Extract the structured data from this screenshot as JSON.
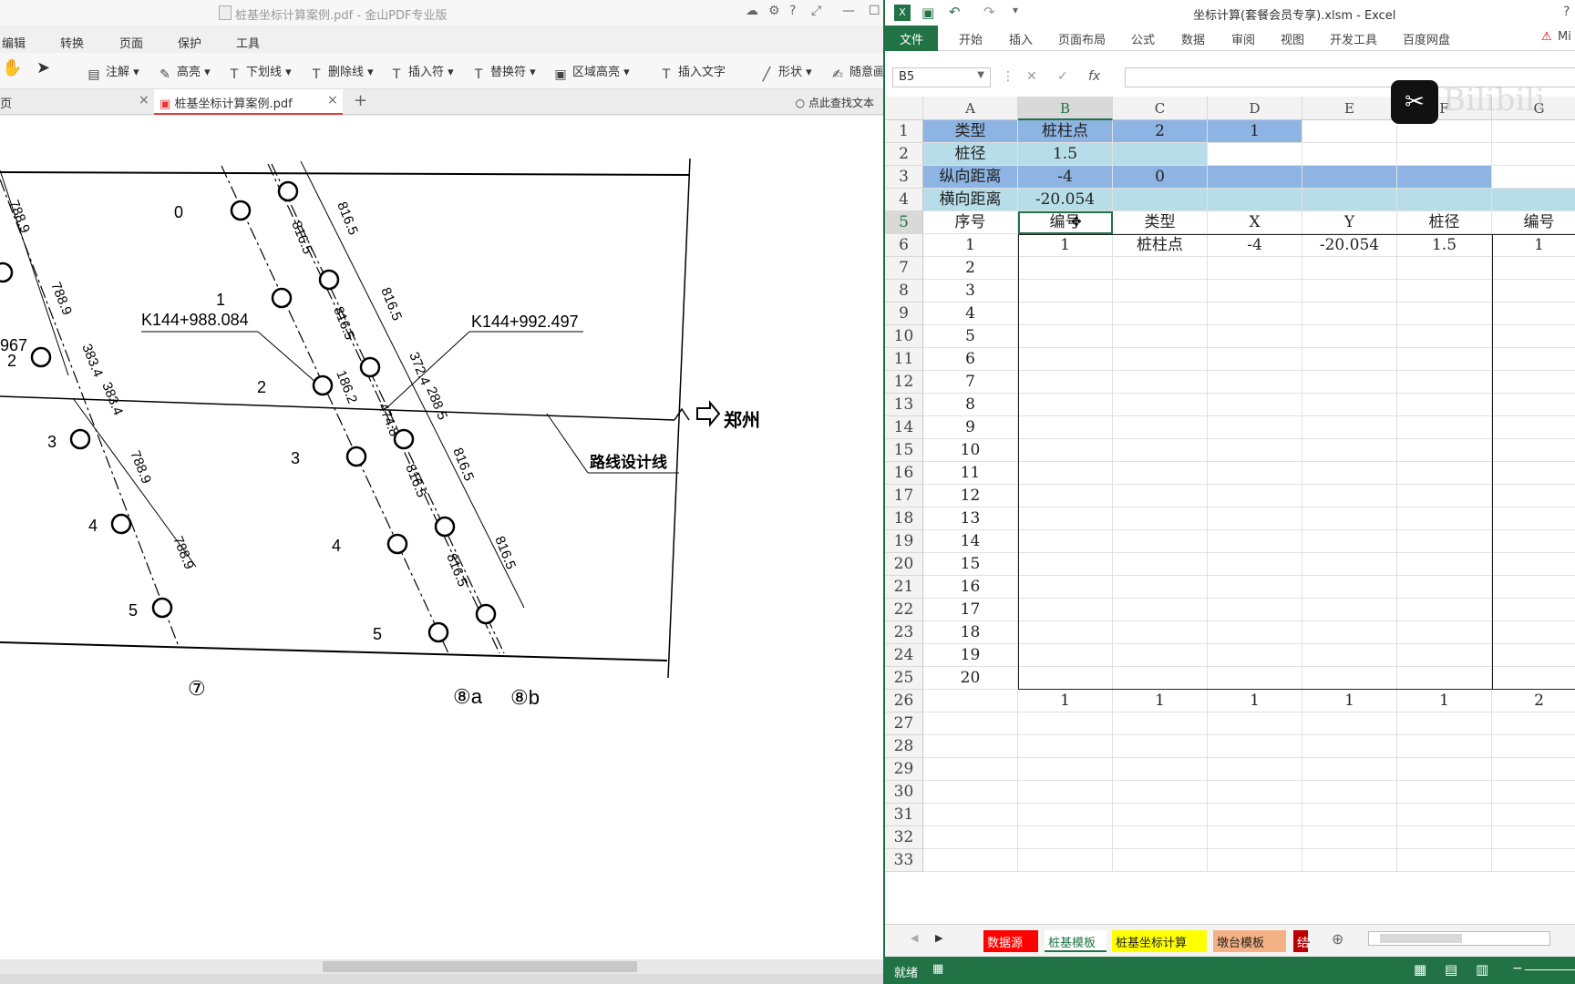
{
  "pdf": {
    "title": "桩基坐标计算案例.pdf - 金山PDF专业版",
    "menu": [
      "编辑",
      "转换",
      "页面",
      "保护",
      "工具"
    ],
    "tools": [
      "注解",
      "高亮",
      "下划线",
      "删除线",
      "插入符",
      "替换符",
      "区域高亮",
      "插入文字",
      "形状",
      "随意画"
    ],
    "tabs": [
      "页",
      "桩基坐标计算案例.pdf"
    ],
    "search_text": "点此查找文本",
    "drawing": {
      "station_left": "K144+988.084",
      "station_right": "K144+992.497",
      "direction": "郑州",
      "route_label": "路线设计线",
      "pier_labels": [
        "⑦",
        "⑧a",
        "⑧b"
      ],
      "dims_left": [
        "788.9",
        "788.9",
        "383.4",
        "383.4",
        "788.9",
        "788.9"
      ],
      "dims_right": [
        "816.5",
        "816.5",
        "816.5",
        "816.5",
        "816.5",
        "816.5",
        "816.5",
        "816.5"
      ],
      "dims_mid": [
        "372.4",
        "288.5",
        "186.2",
        "474.8"
      ],
      "row_numbers": [
        "0",
        "1",
        "2",
        "3",
        "4",
        "5"
      ],
      "partial_left": "967",
      "partial_left_num": "2"
    }
  },
  "excel": {
    "title": "坐标计算(套餐会员专享).xlsm - Excel",
    "ribbon": [
      "文件",
      "开始",
      "插入",
      "页面布局",
      "公式",
      "数据",
      "审阅",
      "视图",
      "开发工具",
      "百度网盘"
    ],
    "ribbon_extra": "Mi",
    "name_box": "B5",
    "columns": [
      "A",
      "B",
      "C",
      "D",
      "E",
      "F",
      "G"
    ],
    "rows": [
      [
        "类型",
        "桩柱点",
        "2",
        "1",
        "",
        "",
        ""
      ],
      [
        "桩径",
        "1.5",
        "",
        "",
        "",
        "",
        ""
      ],
      [
        "纵向距离",
        "-4",
        "0",
        "",
        "",
        "",
        ""
      ],
      [
        "横向距离",
        "-20.054",
        "",
        "",
        "",
        "",
        ""
      ],
      [
        "序号",
        "编号",
        "类型",
        "X",
        "Y",
        "桩径",
        "编号"
      ],
      [
        "1",
        "1",
        "桩柱点",
        "-4",
        "-20.054",
        "1.5",
        "1"
      ],
      [
        "2",
        "",
        "",
        "",
        "",
        "",
        ""
      ],
      [
        "3",
        "",
        "",
        "",
        "",
        "",
        ""
      ],
      [
        "4",
        "",
        "",
        "",
        "",
        "",
        ""
      ],
      [
        "5",
        "",
        "",
        "",
        "",
        "",
        ""
      ],
      [
        "6",
        "",
        "",
        "",
        "",
        "",
        ""
      ],
      [
        "7",
        "",
        "",
        "",
        "",
        "",
        ""
      ],
      [
        "8",
        "",
        "",
        "",
        "",
        "",
        ""
      ],
      [
        "9",
        "",
        "",
        "",
        "",
        "",
        ""
      ],
      [
        "10",
        "",
        "",
        "",
        "",
        "",
        ""
      ],
      [
        "11",
        "",
        "",
        "",
        "",
        "",
        ""
      ],
      [
        "12",
        "",
        "",
        "",
        "",
        "",
        ""
      ],
      [
        "13",
        "",
        "",
        "",
        "",
        "",
        ""
      ],
      [
        "14",
        "",
        "",
        "",
        "",
        "",
        ""
      ],
      [
        "15",
        "",
        "",
        "",
        "",
        "",
        ""
      ],
      [
        "16",
        "",
        "",
        "",
        "",
        "",
        ""
      ],
      [
        "17",
        "",
        "",
        "",
        "",
        "",
        ""
      ],
      [
        "18",
        "",
        "",
        "",
        "",
        "",
        ""
      ],
      [
        "19",
        "",
        "",
        "",
        "",
        "",
        ""
      ],
      [
        "20",
        "",
        "",
        "",
        "",
        "",
        ""
      ],
      [
        "",
        "1",
        "1",
        "1",
        "1",
        "1",
        "2"
      ],
      [
        "",
        "",
        "",
        "",
        "",
        "",
        ""
      ],
      [
        "",
        "",
        "",
        "",
        "",
        "",
        ""
      ],
      [
        "",
        "",
        "",
        "",
        "",
        "",
        ""
      ],
      [
        "",
        "",
        "",
        "",
        "",
        "",
        ""
      ],
      [
        "",
        "",
        "",
        "",
        "",
        "",
        ""
      ],
      [
        "",
        "",
        "",
        "",
        "",
        "",
        ""
      ],
      [
        "",
        "",
        "",
        "",
        "",
        "",
        ""
      ]
    ],
    "sheets": [
      {
        "name": "数据源",
        "color": "#ff0000",
        "text": "#ffffff"
      },
      {
        "name": "桩基模板",
        "color": "#ffffff",
        "text": "#217346"
      },
      {
        "name": "桩基坐标计算",
        "color": "#ffff00",
        "text": "#222222"
      },
      {
        "name": "墩台模板",
        "color": "#f4b183",
        "text": "#222222"
      },
      {
        "name": "结",
        "color": "#c00000",
        "text": "#ffffff"
      }
    ],
    "sheet_more": "...",
    "status": "就绪",
    "watermark": "Bilibili"
  }
}
